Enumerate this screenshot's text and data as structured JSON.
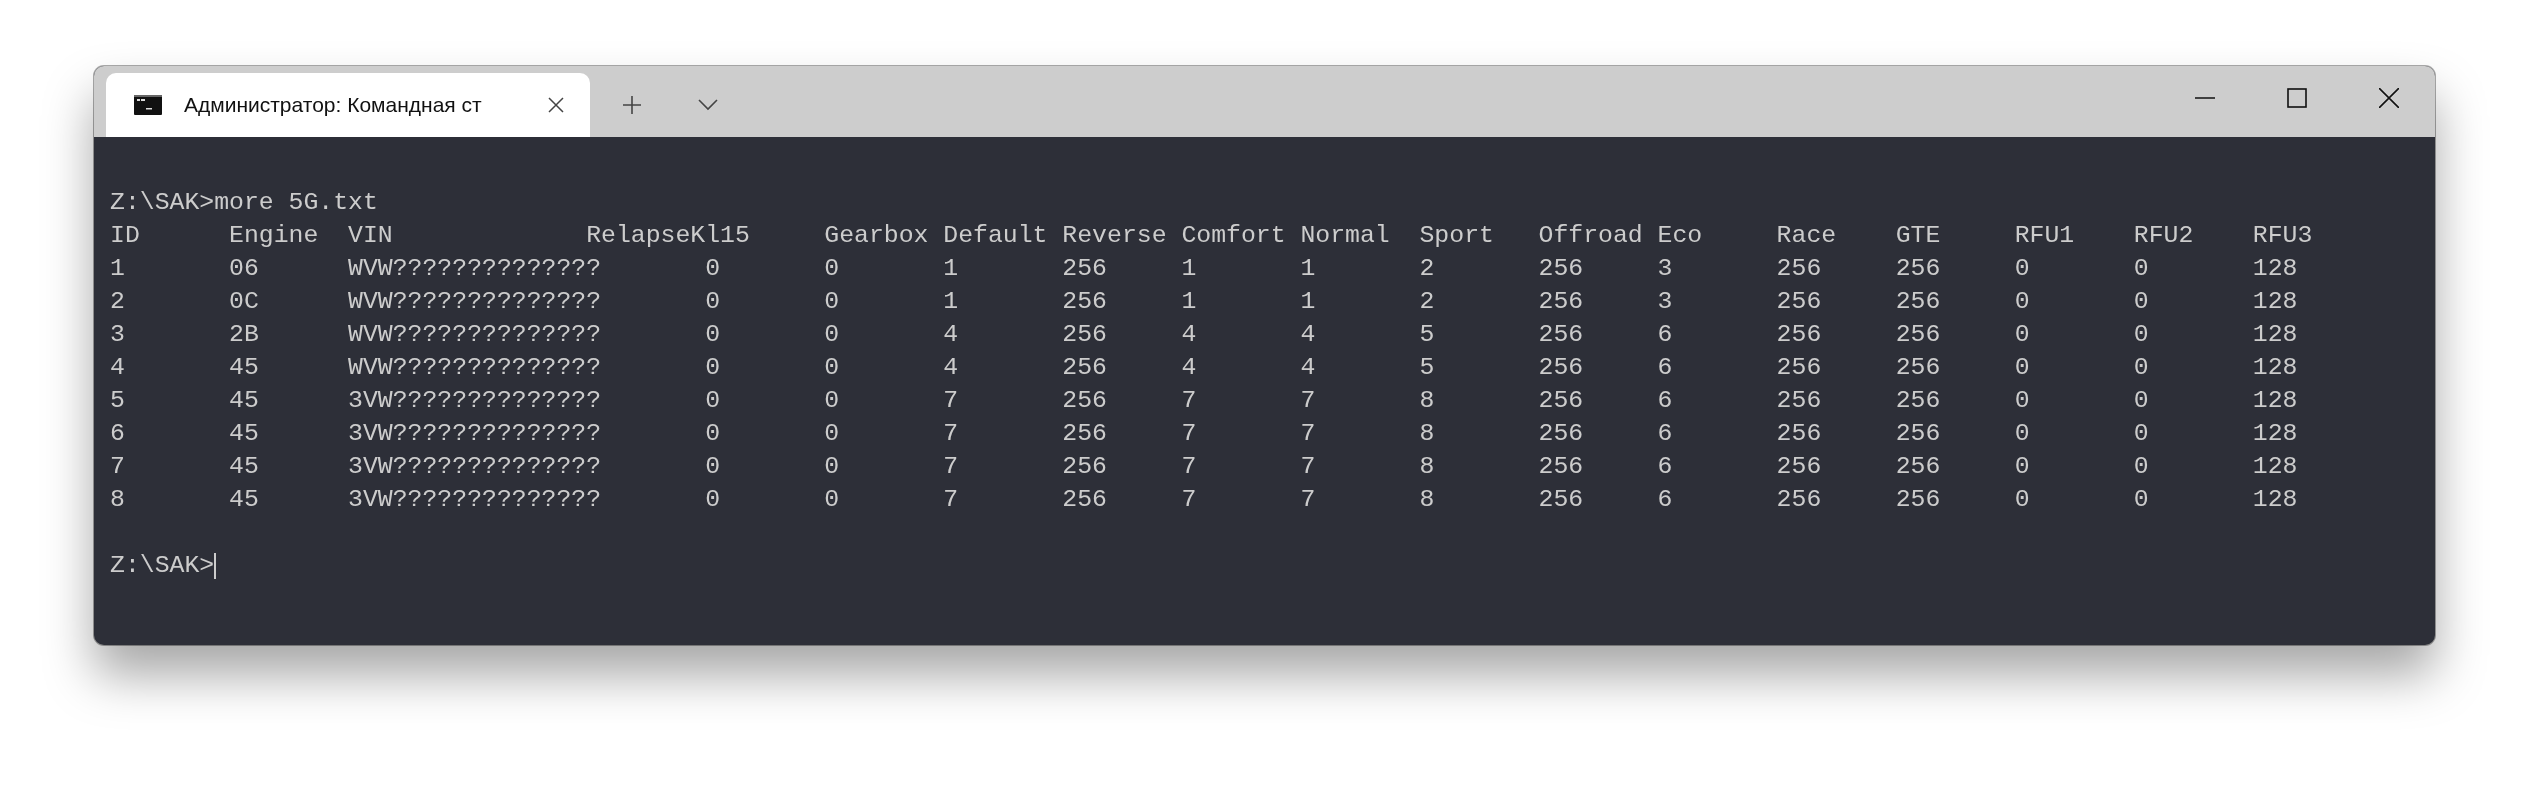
{
  "window": {
    "tabs": [
      {
        "title": "Администратор: Командная ст",
        "selected": true
      }
    ]
  },
  "terminal": {
    "command": "Z:\\SAK>more 5G.txt",
    "output_lines": [
      "ID      Engine  VIN             RelapseKl15     Gearbox Default Reverse Comfort Normal  Sport   Offroad Eco     Race    GTE     RFU1    RFU2    RFU3",
      "1       06      WVW??????????????       0       0       1       256     1       1       2       256     3       256     256     0       0       128",
      "2       0C      WVW??????????????       0       0       1       256     1       1       2       256     3       256     256     0       0       128",
      "3       2B      WVW??????????????       0       0       4       256     4       4       5       256     6       256     256     0       0       128",
      "4       45      WVW??????????????       0       0       4       256     4       4       5       256     6       256     256     0       0       128",
      "5       45      3VW??????????????       0       0       7       256     7       7       8       256     6       256     256     0       0       128",
      "6       45      3VW??????????????       0       0       7       256     7       7       8       256     6       256     256     0       0       128",
      "7       45      3VW??????????????       0       0       7       256     7       7       8       256     6       256     256     0       0       128",
      "8       45      3VW??????????????       0       0       7       256     7       7       8       256     6       256     256     0       0       128"
    ],
    "prompt": "Z:\\SAK>",
    "cursor_visible": true
  }
}
